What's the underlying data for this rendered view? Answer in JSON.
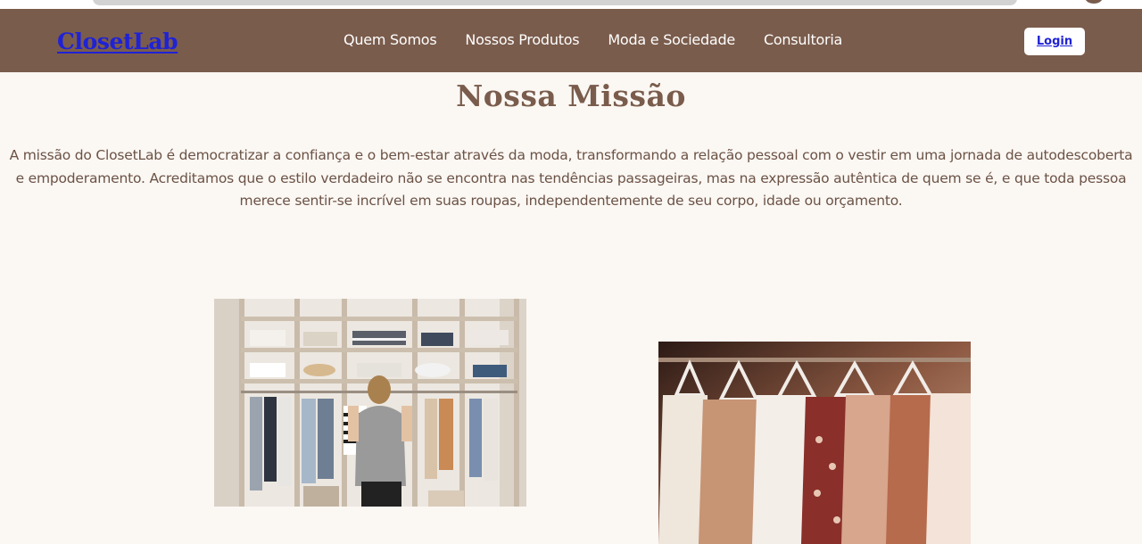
{
  "header": {
    "brand": "ClosetLab",
    "nav": [
      {
        "label": "Quem Somos"
      },
      {
        "label": "Nossos Produtos"
      },
      {
        "label": "Moda e Sociedade"
      },
      {
        "label": "Consultoria"
      }
    ],
    "login_label": "Login"
  },
  "main": {
    "title": "Nossa Missão",
    "mission_text": "A missão do ClosetLab é democratizar a confiança e o bem-estar através da moda, transformando a relação pessoal com o vestir em uma jornada de autodescoberta e empoderamento. Acreditamos que o estilo verdadeiro não se encontra nas tendências passageiras, mas na expressão autêntica de quem se é, e que toda pessoa merece sentir-se incrível em suas roupas, independentemente de seu corpo, idade ou orçamento."
  },
  "colors": {
    "header_bg": "#7A5C4C",
    "page_bg": "#FBF7F3",
    "accent_text": "#7A5C4C",
    "link_blue": "#1F22D6"
  }
}
